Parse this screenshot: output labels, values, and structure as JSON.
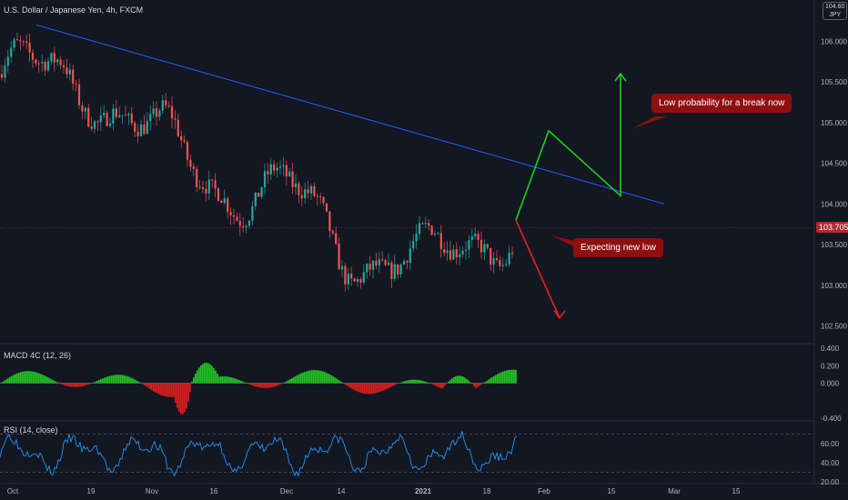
{
  "symbol": {
    "title": "U.S. Dollar / Japanese Yen, 4h, FXCM",
    "currency_badge": "JPY",
    "badge_price": "104.60"
  },
  "current_price": {
    "label": "103.705",
    "value": 103.705,
    "color": "#b22833"
  },
  "colors": {
    "background": "#131722",
    "candle_up": "#26a69a",
    "candle_down": "#ef5350",
    "trendline": "#2962ff",
    "arrow_up": "#19d219",
    "arrow_down": "#e52222",
    "rsi_line": "#2196f3",
    "callout_bg": "#8f0f11"
  },
  "annotations": {
    "callout_break": "Low probability for a break now",
    "callout_low": "Expecting new low"
  },
  "panes": {
    "macd": {
      "label": "MACD 4C (12, 26)"
    },
    "rsi": {
      "label": "RSI (14, close)"
    }
  },
  "chart_data": [
    {
      "type": "candlestick",
      "title": "U.S. Dollar / Japanese Yen, 4h, FXCM",
      "price_axis_ticks": [
        "106.000",
        "105.500",
        "105.000",
        "104.500",
        "104.000",
        "103.500",
        "103.000",
        "102.500"
      ],
      "ylim": [
        102.35,
        106.35
      ],
      "time_axis_ticks": [
        "Oct",
        "19",
        "Nov",
        "16",
        "Dec",
        "14",
        "2021",
        "18",
        "Feb",
        "15",
        "Mar",
        "15"
      ],
      "close_path": [
        {
          "date": "Oct",
          "close": 105.6
        },
        {
          "date": "19",
          "close": 105.5
        },
        {
          "date": "Nov",
          "close": 104.8
        },
        {
          "date": "16",
          "close": 104.3
        },
        {
          "date": "Dec",
          "close": 104.1
        },
        {
          "date": "14",
          "close": 103.5
        },
        {
          "date": "2021",
          "close": 103.2
        },
        {
          "date": "18",
          "close": 103.7
        }
      ],
      "trendline": {
        "from": {
          "date": "Oct",
          "price": 106.2
        },
        "to": {
          "date": "Feb",
          "price": 104.0
        }
      },
      "projection_up": [
        103.8,
        104.9,
        104.1,
        105.6
      ],
      "projection_down": [
        103.8,
        102.6
      ]
    },
    {
      "type": "bar",
      "title": "MACD 4C (12, 26)",
      "axis_ticks": [
        "0.400",
        "0.200",
        "0.000",
        "-0.400"
      ],
      "ylim": [
        -0.4,
        0.4
      ]
    },
    {
      "type": "line",
      "title": "RSI (14, close)",
      "axis_ticks": [
        "60.00",
        "40.00",
        "20.00"
      ],
      "ylim": [
        20,
        80
      ],
      "bands": [
        70,
        30
      ]
    }
  ]
}
